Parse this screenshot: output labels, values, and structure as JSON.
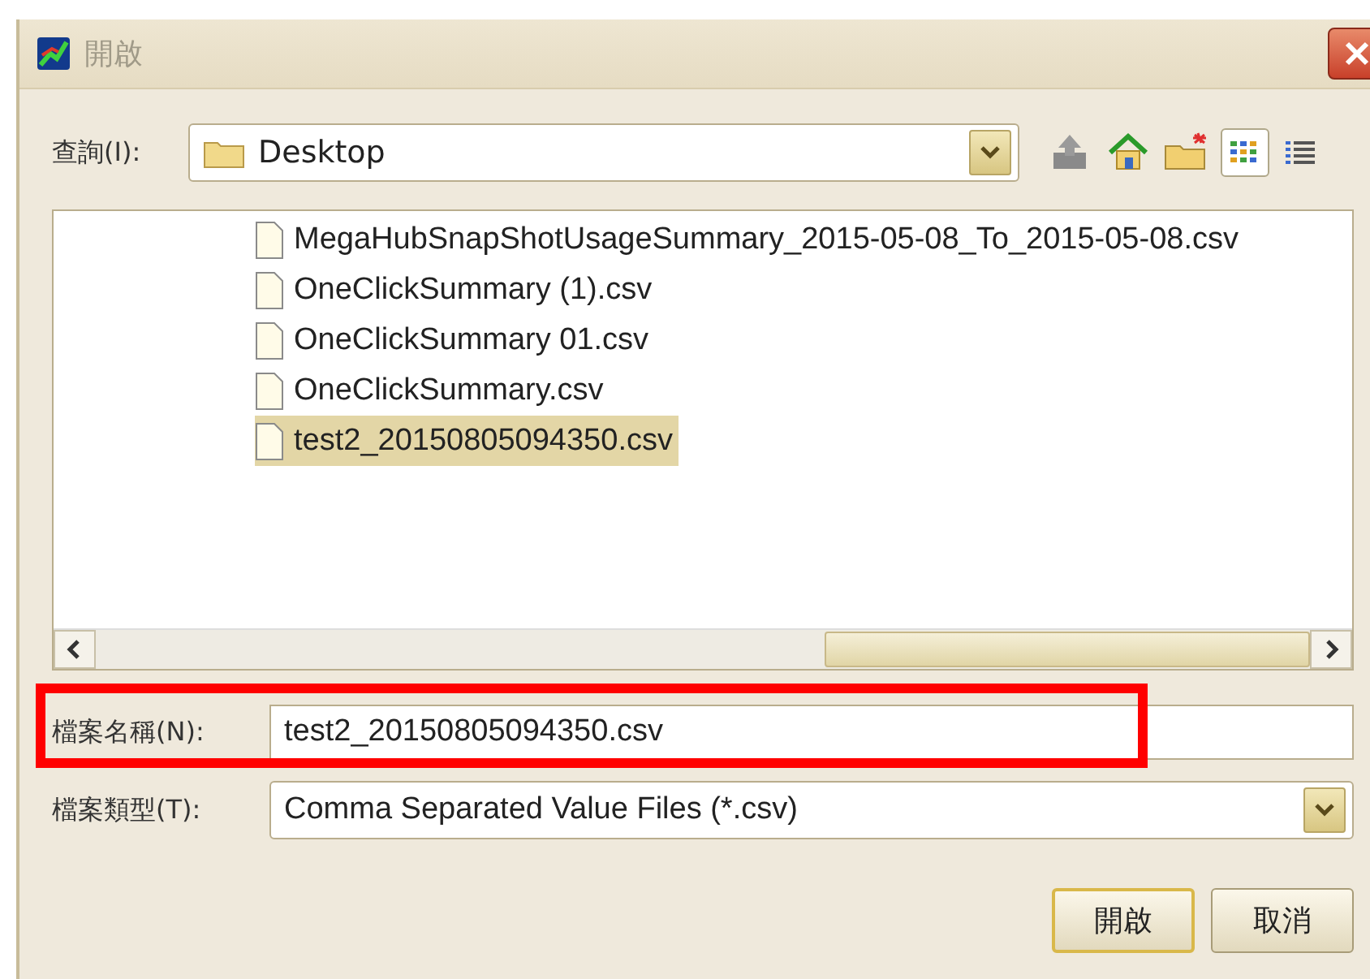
{
  "window": {
    "title": "開啟"
  },
  "look_in": {
    "label": "查詢(I):",
    "value": "Desktop"
  },
  "view_buttons": [
    {
      "kind": "list",
      "selected": true
    },
    {
      "kind": "details",
      "selected": false
    }
  ],
  "files": [
    {
      "name": "MegaHubSnapShotUsageSummary_2015-05-08_To_2015-05-08.csv",
      "selected": false
    },
    {
      "name": "OneClickSummary (1).csv",
      "selected": false
    },
    {
      "name": "OneClickSummary 01.csv",
      "selected": false
    },
    {
      "name": "OneClickSummary.csv",
      "selected": false
    },
    {
      "name": "test2_20150805094350.csv",
      "selected": true
    }
  ],
  "file_name": {
    "label": "檔案名稱(N):",
    "value": "test2_20150805094350.csv"
  },
  "file_type": {
    "label": "檔案類型(T):",
    "value": "Comma Separated Value Files (*.csv)"
  },
  "buttons": [
    "開啟",
    "取消"
  ]
}
